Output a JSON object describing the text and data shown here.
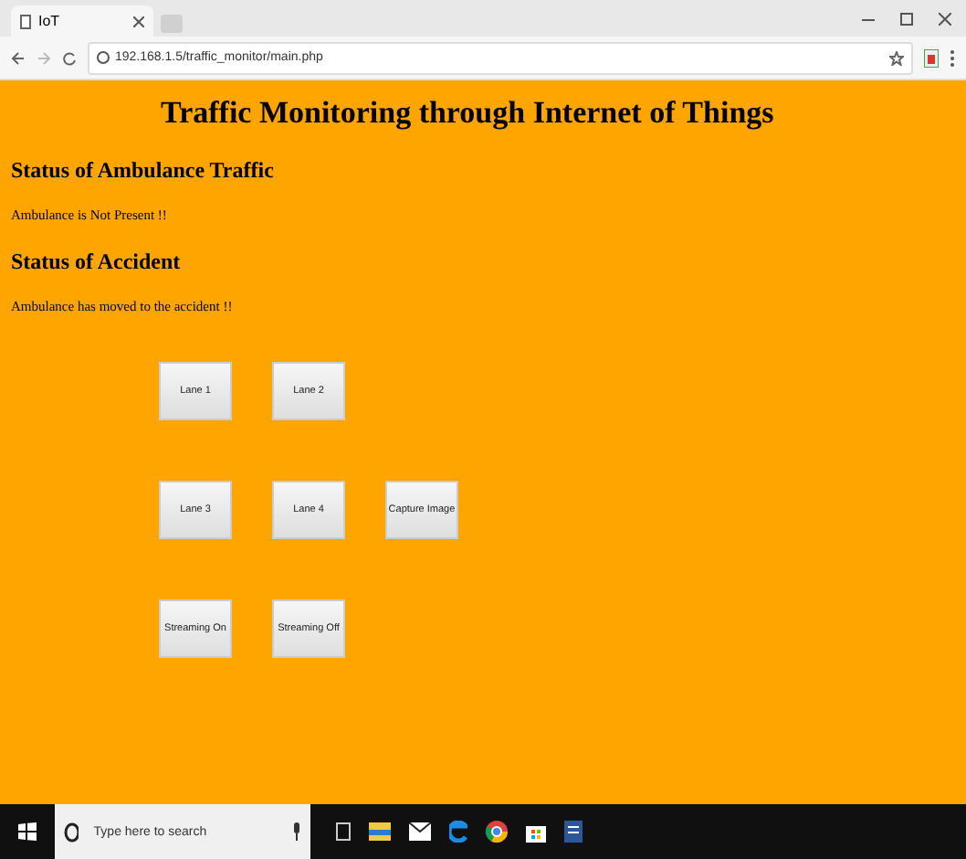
{
  "browser": {
    "tab_title": "IoT",
    "address": "192.168.1.5/traffic_monitor/main.php"
  },
  "page": {
    "title": "Traffic Monitoring through Internet of Things",
    "sections": [
      {
        "heading": "Status of Ambulance Traffic",
        "text": "Ambulance is Not Present !!"
      },
      {
        "heading": "Status of Accident",
        "text": "Ambulance has moved to the accident !!"
      }
    ],
    "button_rows": [
      [
        "Lane 1",
        "Lane 2"
      ],
      [
        "Lane 3",
        "Lane 4",
        "Capture Image"
      ],
      [
        "Streaming On",
        "Streaming Off"
      ]
    ]
  },
  "taskbar": {
    "search": {
      "placeholder": "Type here to search"
    }
  }
}
